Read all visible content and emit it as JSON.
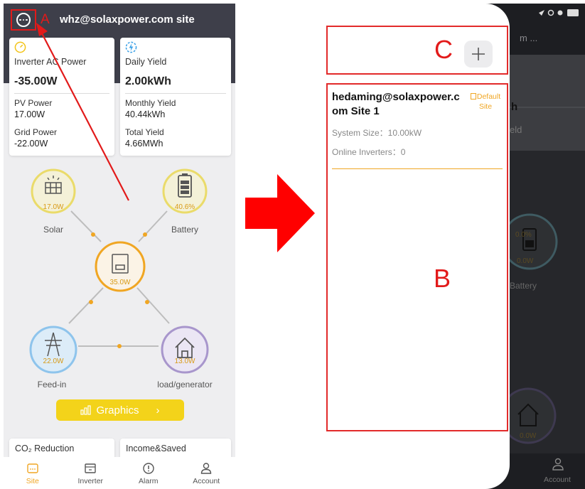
{
  "left": {
    "annotation_a": "A",
    "site_title": "whz@solaxpower.com site",
    "inverter_card": {
      "title": "Inverter AC Power",
      "value": "-35.00W",
      "pv_label": "PV Power",
      "pv_value": "17.00W",
      "grid_label": "Grid Power",
      "grid_value": "-22.00W"
    },
    "yield_card": {
      "title": "Daily Yield",
      "value": "2.00kWh",
      "monthly_label": "Monthly Yield",
      "monthly_value": "40.44kWh",
      "total_label": "Total Yield",
      "total_value": "4.66MWh"
    },
    "flow": {
      "solar_value": "17.0W",
      "solar_label": "Solar",
      "battery_value": "40.6%",
      "battery_label": "Battery",
      "inverter_value": "35.0W",
      "feedin_value": "22.0W",
      "feedin_label": "Feed-in",
      "load_value": "13.0W",
      "load_label": "load/generator"
    },
    "graphics_label": "Graphics",
    "co2_label": "CO₂ Reduction",
    "income_label": "Income&Saved",
    "nav": [
      {
        "label": "Site",
        "icon": "site-icon",
        "active": true
      },
      {
        "label": "Inverter",
        "icon": "inverter-icon",
        "active": false
      },
      {
        "label": "Alarm",
        "icon": "alarm-icon",
        "active": false
      },
      {
        "label": "Account",
        "icon": "account-icon",
        "active": false
      }
    ]
  },
  "right": {
    "annotation_c": "C",
    "annotation_b": "B",
    "site_name": "hedaming@solaxpower.com Site 1",
    "default_tag": "Default Site",
    "system_size": "System Size：10.00kW",
    "online_inverters": "Online Inverters：0",
    "bg_partial_top": "m ...",
    "bg_partial_h": "h",
    "bg_partial_eld": "eld",
    "bg_battery_pct": "0.0%",
    "bg_battery_val": "0.0W",
    "bg_battery_label": "Battery",
    "bg_load_val": "0.0W",
    "bg_account_label": "Account"
  },
  "colors": {
    "accent": "#f0a623",
    "annotation_red": "#e21a1a",
    "header_dark": "#3e3f4a",
    "graphics_yellow": "#f3d31a"
  }
}
